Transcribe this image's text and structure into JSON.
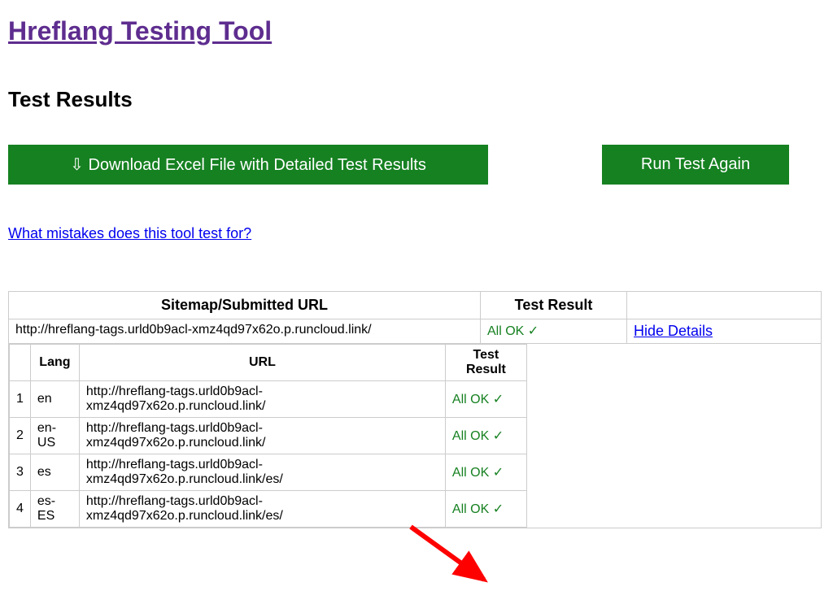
{
  "page": {
    "title": "Hreflang Testing Tool",
    "subtitle": "Test Results"
  },
  "buttons": {
    "download": "⇩ Download Excel File with Detailed Test Results",
    "run_again": "Run Test Again"
  },
  "links": {
    "mistakes": "What mistakes does this tool test for?",
    "hide_details": "Hide Details"
  },
  "table": {
    "headers": {
      "sitemap": "Sitemap/Submitted URL",
      "test_result": "Test Result",
      "lang": "Lang",
      "url": "URL",
      "inner_test_result": "Test Result"
    },
    "main_row": {
      "url": "http://hreflang-tags.urld0b9acl-xmz4qd97x62o.p.runcloud.link/",
      "result": "All OK",
      "check": "✓"
    },
    "details": [
      {
        "num": "1",
        "lang": "en",
        "url": "http://hreflang-tags.urld0b9acl-xmz4qd97x62o.p.runcloud.link/",
        "result": "All OK",
        "check": "✓"
      },
      {
        "num": "2",
        "lang": "en-US",
        "url": "http://hreflang-tags.urld0b9acl-xmz4qd97x62o.p.runcloud.link/",
        "result": "All OK",
        "check": "✓"
      },
      {
        "num": "3",
        "lang": "es",
        "url": "http://hreflang-tags.urld0b9acl-xmz4qd97x62o.p.runcloud.link/es/",
        "result": "All OK",
        "check": "✓"
      },
      {
        "num": "4",
        "lang": "es-ES",
        "url": "http://hreflang-tags.urld0b9acl-xmz4qd97x62o.p.runcloud.link/es/",
        "result": "All OK",
        "check": "✓"
      }
    ]
  },
  "annotation": {
    "arrow_color": "#ff0000"
  }
}
